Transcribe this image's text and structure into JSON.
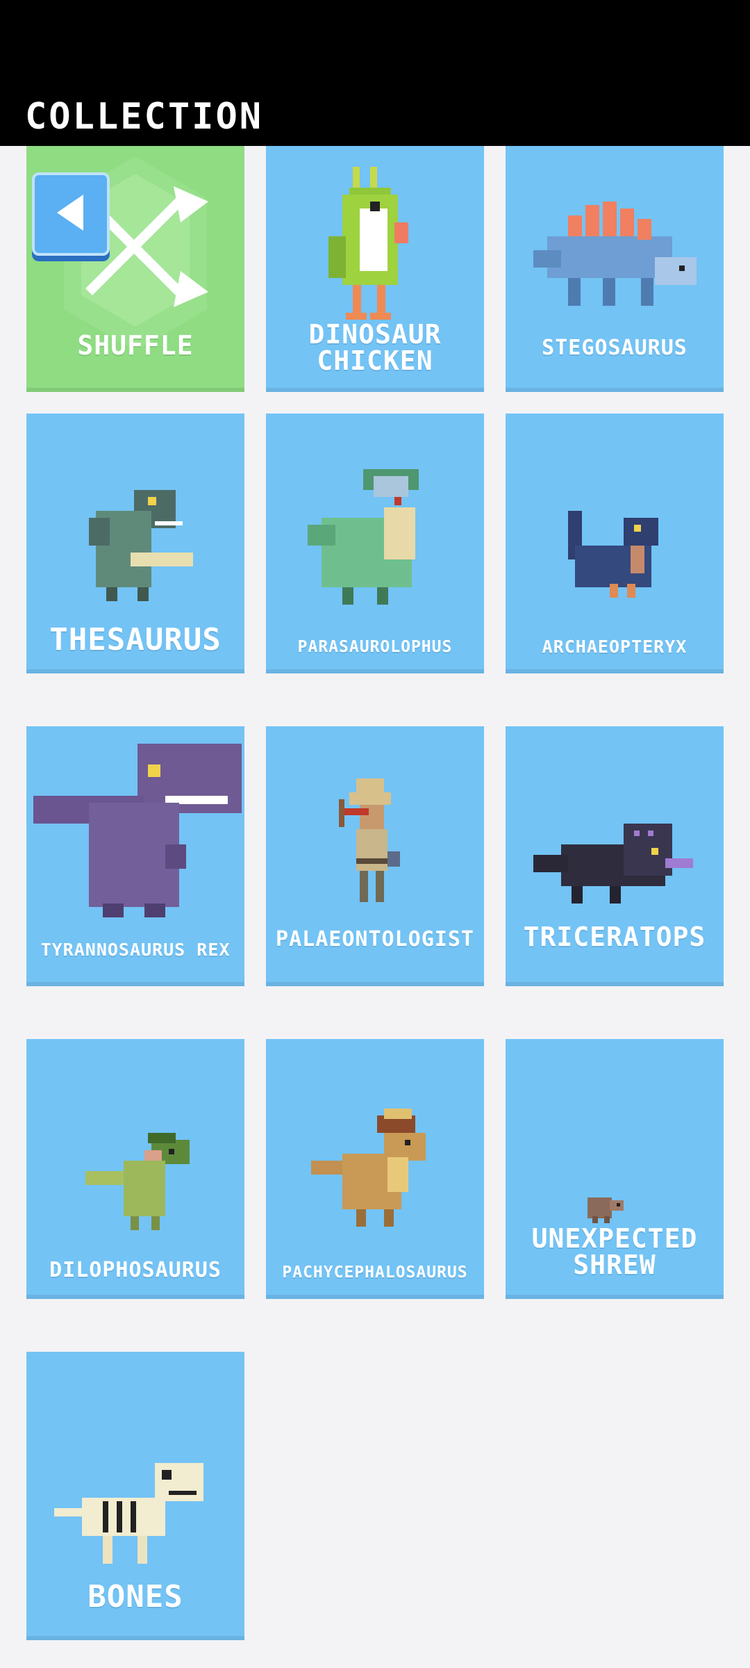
{
  "header": {
    "title": "COLLECTION"
  },
  "back_button": {
    "icon": "back-arrow-icon"
  },
  "items": [
    {
      "label": "SHUFFLE",
      "icon": "shuffle-icon",
      "color": "#8fdc83"
    },
    {
      "label": "DINOSAUR CHICKEN",
      "icon": "dinosaur-chicken-icon"
    },
    {
      "label": "STEGOSAURUS",
      "icon": "stegosaurus-icon"
    },
    {
      "label": "THESAURUS",
      "icon": "thesaurus-icon"
    },
    {
      "label": "PARASAUROLOPHUS",
      "icon": "parasaurolophus-icon"
    },
    {
      "label": "ARCHAEOPTERYX",
      "icon": "archaeopteryx-icon"
    },
    {
      "label": "TYRANNOSAURUS REX",
      "icon": "tyrannosaurus-rex-icon"
    },
    {
      "label": "PALAEONTOLOGIST",
      "icon": "palaeontologist-icon"
    },
    {
      "label": "TRICERATOPS",
      "icon": "triceratops-icon"
    },
    {
      "label": "DILOPHOSAURUS",
      "icon": "dilophosaurus-icon"
    },
    {
      "label": "PACHYCEPHALOSAURUS",
      "icon": "pachycephalosaurus-icon"
    },
    {
      "label": "UNEXPECTED SHREW",
      "icon": "shrew-icon"
    },
    {
      "label": "BONES",
      "icon": "skeleton-icon"
    }
  ],
  "colors": {
    "card": "#73c3f5",
    "shuffle_card": "#8fdc83",
    "header": "#000000",
    "background": "#f3f3f5"
  }
}
